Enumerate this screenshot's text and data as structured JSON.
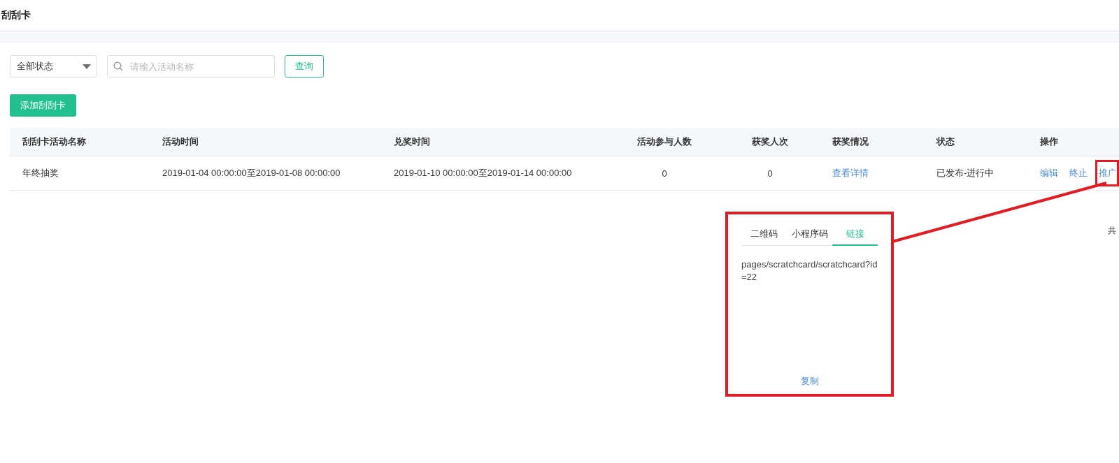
{
  "page_title": "刮刮卡",
  "filters": {
    "status_select": "全部状态",
    "search": {
      "placeholder": "请输入活动名称"
    },
    "query_button": "查询"
  },
  "add_button": "添加刮刮卡",
  "table": {
    "columns": [
      {
        "label": "刮刮卡活动名称",
        "kind": "text"
      },
      {
        "label": "活动时间",
        "kind": "text"
      },
      {
        "label": "兑奖时间",
        "kind": "text"
      },
      {
        "label": "活动参与人数",
        "kind": "number"
      },
      {
        "label": "获奖人次",
        "kind": "number"
      },
      {
        "label": "获奖情况",
        "kind": "text"
      },
      {
        "label": "状态",
        "kind": "text"
      },
      {
        "label": "操作",
        "kind": "text"
      }
    ],
    "rows": [
      {
        "name": "年终抽奖",
        "activity_time": "2019-01-04 00:00:00至2019-01-08 00:00:00",
        "redeem_time": "2019-01-10 00:00:00至2019-01-14 00:00:00",
        "participants": "0",
        "winners": "0",
        "win_details_link": "查看详情",
        "status": "已发布-进行中",
        "actions": [
          "编辑",
          "终止",
          "推广"
        ]
      }
    ]
  },
  "pagination_text": "共",
  "promote_popover": {
    "tabs": [
      {
        "label": "二维码",
        "selected": false
      },
      {
        "label": "小程序码",
        "selected": false
      },
      {
        "label": "链接",
        "selected": true
      }
    ],
    "link": "pages/scratchcard/scratchcard?id=22",
    "copy_button": "复制"
  }
}
